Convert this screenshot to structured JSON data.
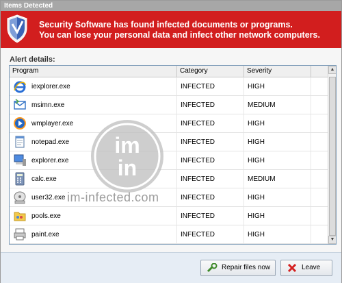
{
  "window": {
    "title": "Items Detected"
  },
  "banner": {
    "line1": "Security Software has found infected documents or programs.",
    "line2": "You can lose your personal data and infect other network computers."
  },
  "alert_label": "Alert details:",
  "table": {
    "headers": {
      "program": "Program",
      "category": "Category",
      "severity": "Severity"
    },
    "rows": [
      {
        "program": "iexplorer.exe",
        "category": "INFECTED",
        "severity": "HIGH",
        "icon": "internet-explorer-icon"
      },
      {
        "program": "msimn.exe",
        "category": "INFECTED",
        "severity": "MEDIUM",
        "icon": "mail-client-icon"
      },
      {
        "program": "wmplayer.exe",
        "category": "INFECTED",
        "severity": "HIGH",
        "icon": "media-player-icon"
      },
      {
        "program": "notepad.exe",
        "category": "INFECTED",
        "severity": "HIGH",
        "icon": "notepad-icon"
      },
      {
        "program": "explorer.exe",
        "category": "INFECTED",
        "severity": "HIGH",
        "icon": "computer-icon"
      },
      {
        "program": "calc.exe",
        "category": "INFECTED",
        "severity": "MEDIUM",
        "icon": "calculator-icon"
      },
      {
        "program": "user32.exe",
        "category": "INFECTED",
        "severity": "HIGH",
        "icon": "disk-drive-icon"
      },
      {
        "program": "pools.exe",
        "category": "INFECTED",
        "severity": "HIGH",
        "icon": "folder-icon"
      },
      {
        "program": "paint.exe",
        "category": "INFECTED",
        "severity": "HIGH",
        "icon": "paint-printer-icon"
      }
    ]
  },
  "watermark": {
    "logo_text": "im in",
    "site": "im-infected.com"
  },
  "buttons": {
    "repair": "Repair files now",
    "leave": "Leave"
  },
  "colors": {
    "banner": "#d21e1e",
    "footer": "#e6edf5"
  }
}
